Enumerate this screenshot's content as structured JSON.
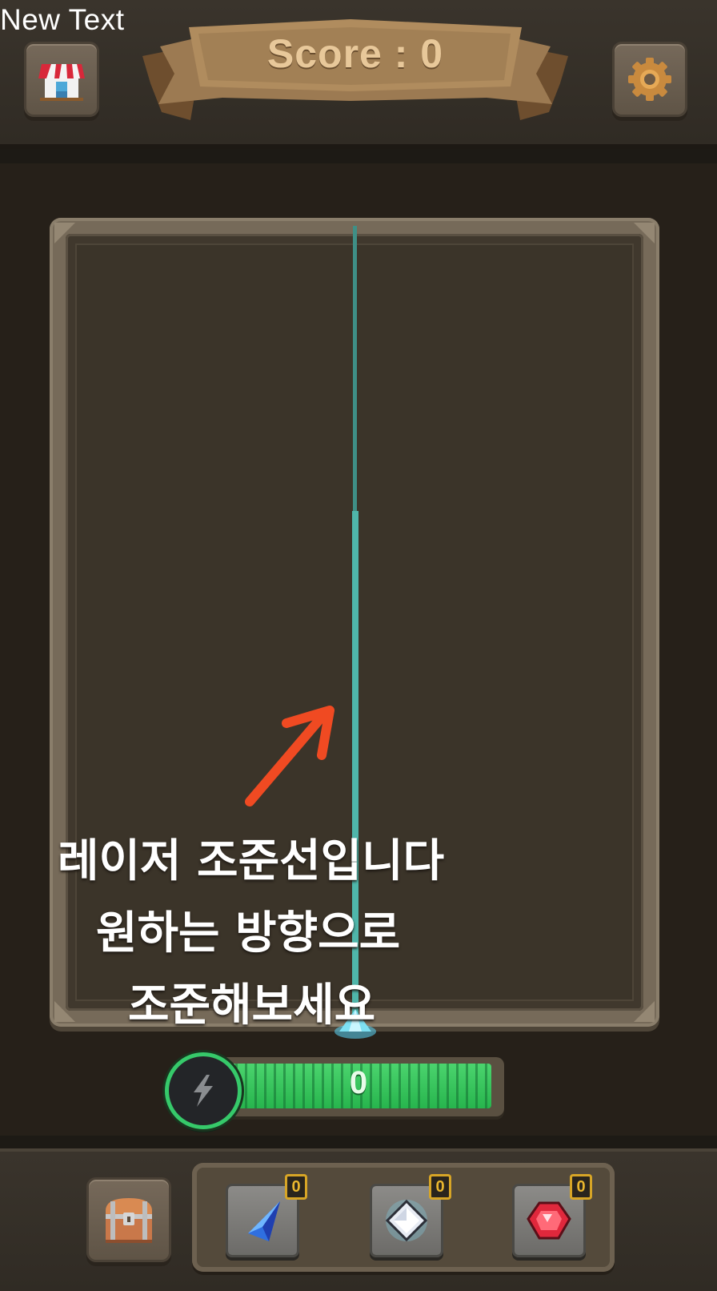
{
  "debug_label": "New Text",
  "header": {
    "score_text": "Score : 0",
    "shop_icon": "shop-icon",
    "settings_icon": "gear-icon"
  },
  "board": {
    "hint_lines": [
      "레이저 조준선입니다",
      "원하는 방향으로",
      "조준해보세요"
    ],
    "laser_color": "#4fb6aa",
    "arrow_color": "#f04a22"
  },
  "energy": {
    "value": "0",
    "icon": "lightning-icon",
    "fill_fraction": 1.0,
    "fill_color": "#2fbf55"
  },
  "footer": {
    "chest_icon": "treasure-chest-icon",
    "gems": [
      {
        "name": "blue-gem",
        "icon": "blue-crystal-icon",
        "count": "0",
        "color": "#2f6fe0"
      },
      {
        "name": "white-gem",
        "icon": "white-diamond-icon",
        "count": "0",
        "color": "#e8ecf4"
      },
      {
        "name": "red-gem",
        "icon": "red-ruby-icon",
        "count": "0",
        "color": "#e0283c"
      }
    ]
  }
}
